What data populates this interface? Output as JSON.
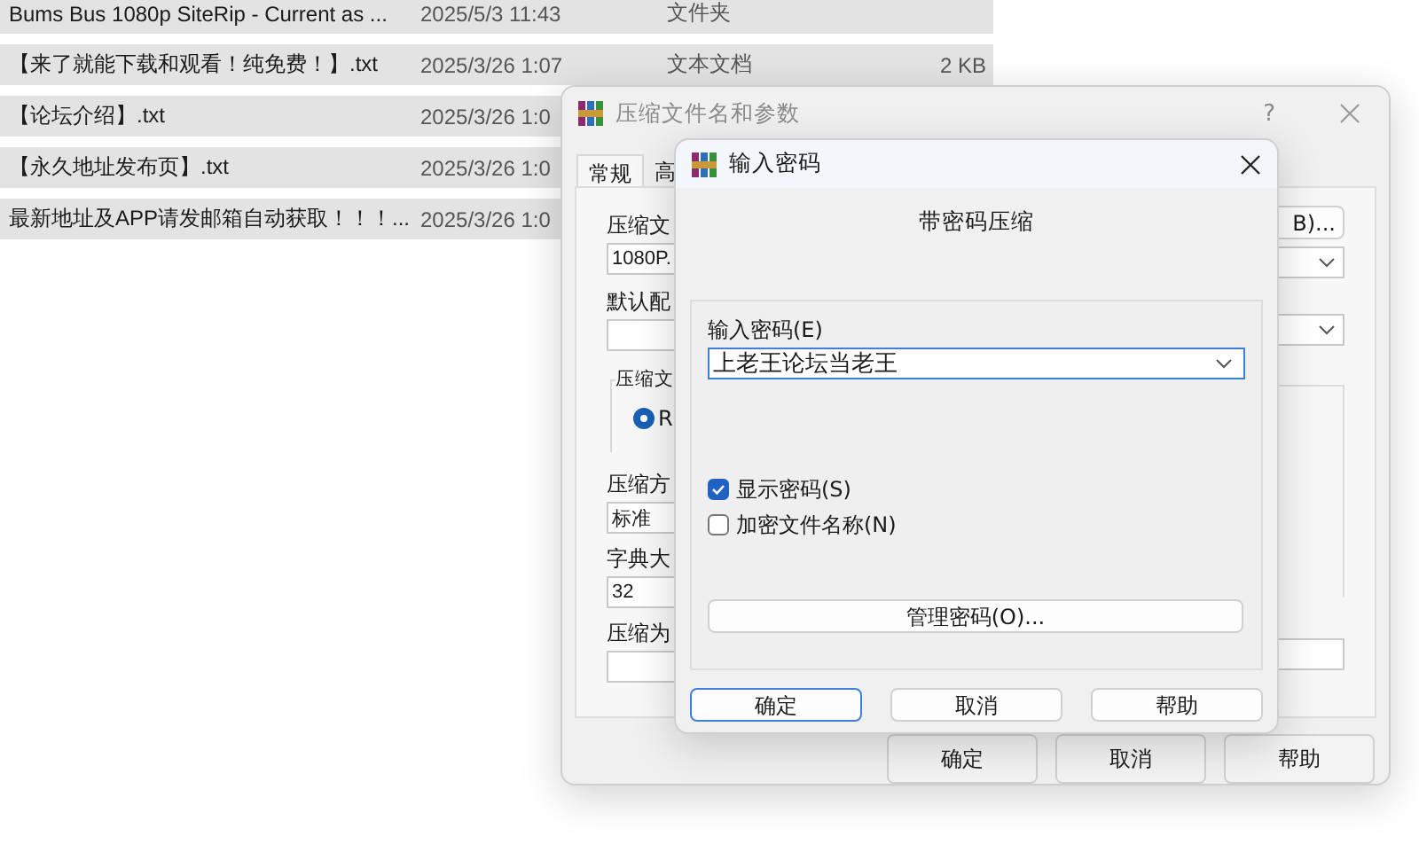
{
  "file_list": {
    "rows": [
      {
        "name": "Bums Bus 1080p SiteRip - Current as ...",
        "date": "2025/5/3 11:43",
        "type": "文件夹",
        "size": "",
        "selected": true
      },
      {
        "name": "【来了就能下载和观看！纯免费！】.txt",
        "date": "2025/3/26 1:07",
        "type": "文本文档",
        "size": "2 KB",
        "selected": true
      },
      {
        "name": "【论坛介绍】.txt",
        "date": "2025/3/26 1:0",
        "selected": true
      },
      {
        "name": "【永久地址发布页】.txt",
        "date": "2025/3/26 1:0",
        "selected": true
      },
      {
        "name": "最新地址及APP请发邮箱自动获取！！！...",
        "date": "2025/3/26 1:0",
        "selected": true
      }
    ]
  },
  "archive_dialog": {
    "title": "压缩文件名和参数",
    "help": "?",
    "tabs": [
      {
        "label": "常规",
        "selected": true
      },
      {
        "label": "高",
        "selected": false
      }
    ],
    "archive_name_label": "压缩文",
    "archive_name_value": "1080P.",
    "browse_button": "B)...",
    "profile_label": "默认配",
    "format_group_label": "压缩文",
    "format_radio": {
      "label": "R",
      "selected": true
    },
    "method_label": "压缩方",
    "method_value": "标准",
    "dictionary_label": "字典大",
    "dictionary_value": "32",
    "split_label": "压缩为",
    "buttons": [
      "确定",
      "取消",
      "帮助"
    ]
  },
  "password_dialog": {
    "title": "输入密码",
    "heading": "带密码压缩",
    "password_label": "输入密码(E)",
    "password_value": "上老王论坛当老王",
    "options": [
      {
        "label": "显示密码(S)",
        "checked": true
      },
      {
        "label": "加密文件名称(N)",
        "checked": false
      }
    ],
    "manage_button": "管理密码(O)...",
    "buttons": [
      {
        "label": "确定",
        "default": true
      },
      {
        "label": "取消",
        "default": false
      },
      {
        "label": "帮助",
        "default": false
      }
    ]
  }
}
